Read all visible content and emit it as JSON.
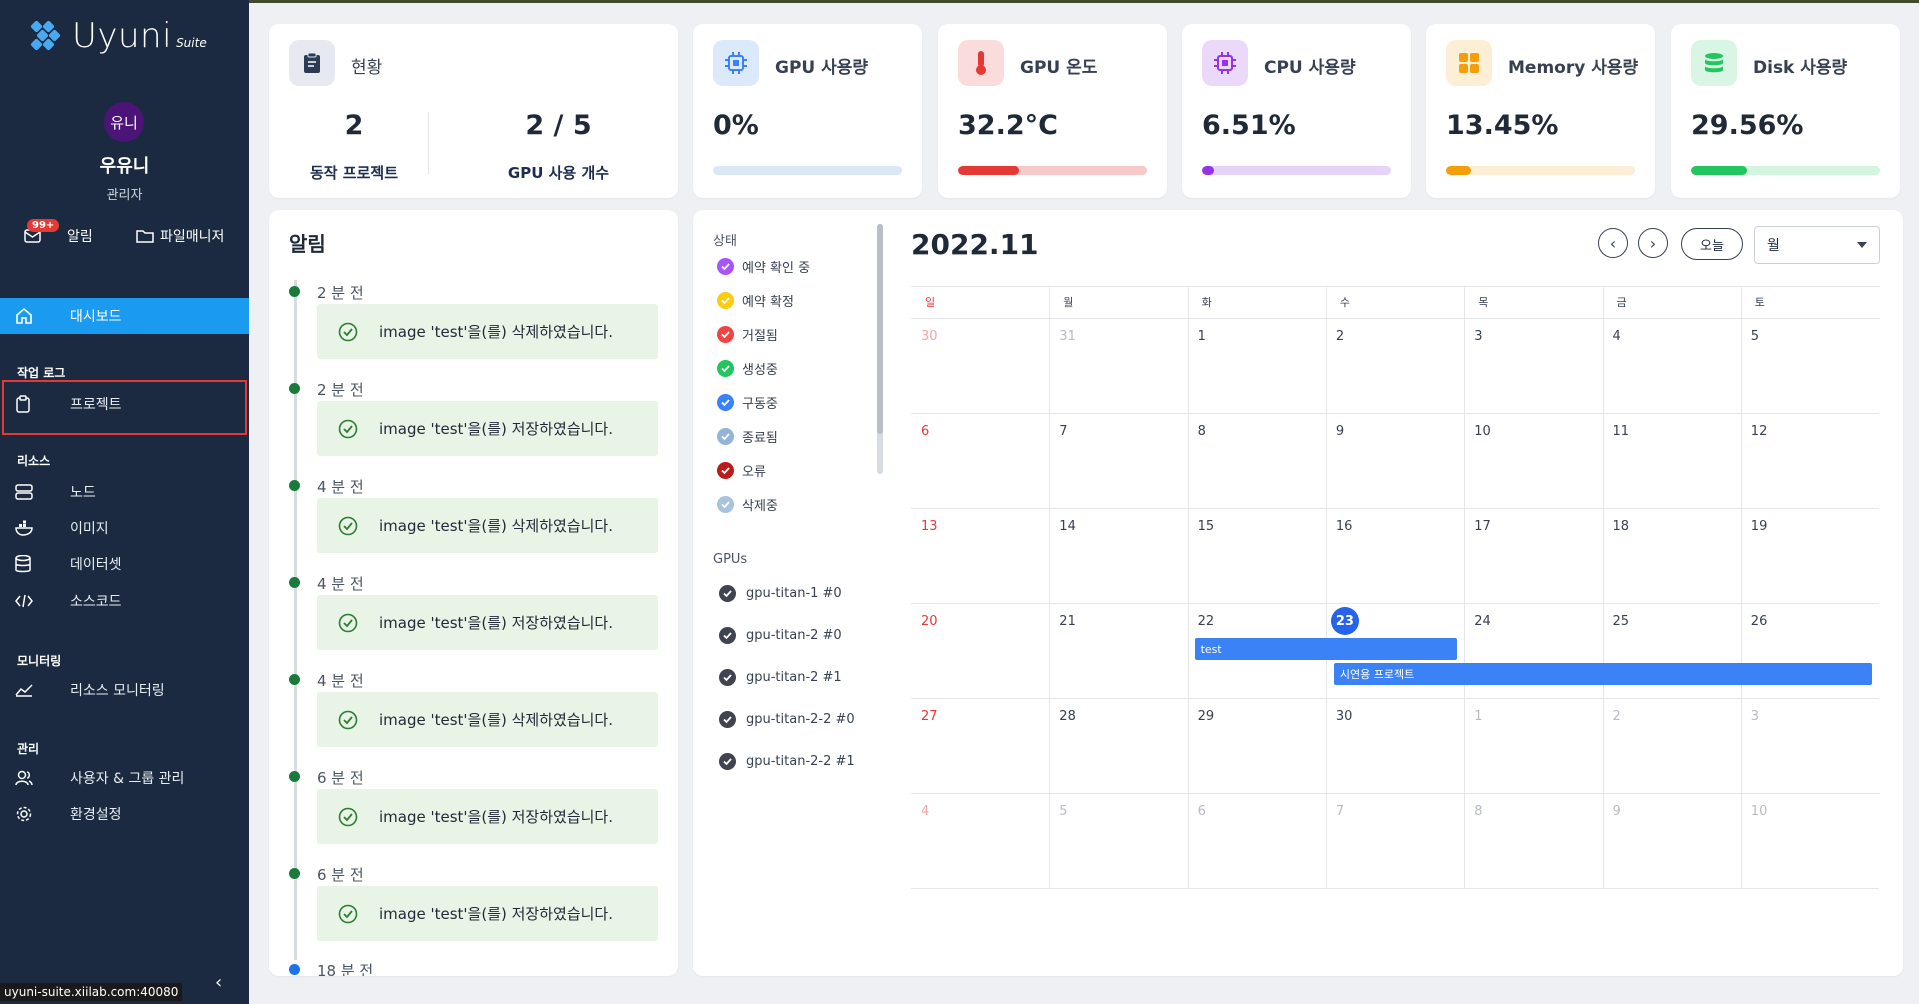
{
  "sidebar": {
    "logo_word": "Uyuni",
    "logo_suite": "Suite",
    "avatar_text": "유니",
    "user_name": "우유니",
    "user_role": "관리자",
    "alert_badge": "99+",
    "alert_label": "알림",
    "filemanager_label": "파일매니저",
    "dashboard": "대시보드",
    "section_worklog": "작업 로그",
    "project": "프로젝트",
    "section_resource": "리소스",
    "node": "노드",
    "image": "이미지",
    "dataset": "데이터셋",
    "sourcecode": "소스코드",
    "section_monitoring": "모니터링",
    "resource_monitoring": "리소스 모니터링",
    "section_admin": "관리",
    "user_group": "사용자 & 그룹 관리",
    "settings": "환경설정",
    "collapse_glyph": "‹"
  },
  "status_url": "uyuni-suite.xiilab.com:40080",
  "summary": {
    "title": "현황",
    "projects_value": "2",
    "projects_label": "동작 프로젝트",
    "gpu_value": "2 / 5",
    "gpu_label": "GPU 사용 개수"
  },
  "metrics": [
    {
      "title": "GPU 사용량",
      "value": "0%",
      "percent": 0,
      "color": "#3b82f6",
      "track": "#dbe6f7",
      "iconbg": "#dbe9fb",
      "icon": "chip-icon"
    },
    {
      "title": "GPU 온도",
      "value": "32.2°C",
      "percent": 32.2,
      "color": "#e53935",
      "track": "#f7c9c9",
      "iconbg": "#fbdcdc",
      "icon": "thermometer-icon"
    },
    {
      "title": "CPU 사용량",
      "value": "6.51%",
      "percent": 6.51,
      "color": "#9333ea",
      "track": "#e6d3f8",
      "iconbg": "#ead9f9",
      "icon": "chip-icon"
    },
    {
      "title": "Memory 사용량",
      "value": "13.45%",
      "percent": 13.45,
      "color": "#f59e0b",
      "track": "#fdeed6",
      "iconbg": "#fdeed6",
      "icon": "memory-icon"
    },
    {
      "title": "Disk 사용량",
      "value": "29.56%",
      "percent": 29.56,
      "color": "#22c55e",
      "track": "#d3f4df",
      "iconbg": "#d9f5e3",
      "icon": "database-icon"
    }
  ],
  "notifications": {
    "title": "알림",
    "items": [
      {
        "time": "2 분 전",
        "message": "image 'test'을(를) 삭제하였습니다."
      },
      {
        "time": "2 분 전",
        "message": "image 'test'을(를) 저장하였습니다."
      },
      {
        "time": "4 분 전",
        "message": "image 'test'을(를) 삭제하였습니다."
      },
      {
        "time": "4 분 전",
        "message": "image 'test'을(를) 저장하였습니다."
      },
      {
        "time": "4 분 전",
        "message": "image 'test'을(를) 삭제하였습니다."
      },
      {
        "time": "6 분 전",
        "message": "image 'test'을(를) 저장하였습니다."
      },
      {
        "time": "6 분 전",
        "message": "image 'test'을(를) 저장하였습니다."
      }
    ],
    "last_time": "18 분 전"
  },
  "legend": {
    "status_heading": "상태",
    "statuses": [
      {
        "label": "예약 확인 중",
        "color": "#a855f7"
      },
      {
        "label": "예약 확정",
        "color": "#facc15"
      },
      {
        "label": "거절됨",
        "color": "#ef4444"
      },
      {
        "label": "생성중",
        "color": "#22c55e"
      },
      {
        "label": "구동중",
        "color": "#3b82f6"
      },
      {
        "label": "종료됨",
        "color": "#93b4d8"
      },
      {
        "label": "오류",
        "color": "#b91c1c"
      },
      {
        "label": "삭제중",
        "color": "#a9c3dd"
      }
    ],
    "gpus_heading": "GPUs",
    "gpus": [
      "gpu-titan-1 #0",
      "gpu-titan-2 #0",
      "gpu-titan-2 #1",
      "gpu-titan-2-2 #0",
      "gpu-titan-2-2 #1"
    ]
  },
  "calendar": {
    "title": "2022.11",
    "prev": "‹",
    "next": "›",
    "today_label": "오늘",
    "view_label": "월",
    "weekdays": [
      "일",
      "월",
      "화",
      "수",
      "목",
      "금",
      "토"
    ],
    "weeks": [
      [
        "30",
        "31",
        "1",
        "2",
        "3",
        "4",
        "5"
      ],
      [
        "6",
        "7",
        "8",
        "9",
        "10",
        "11",
        "12"
      ],
      [
        "13",
        "14",
        "15",
        "16",
        "17",
        "18",
        "19"
      ],
      [
        "20",
        "21",
        "22",
        "23",
        "24",
        "25",
        "26"
      ],
      [
        "27",
        "28",
        "29",
        "30",
        "1",
        "2",
        "3"
      ],
      [
        "4",
        "5",
        "6",
        "7",
        "8",
        "9",
        "10"
      ]
    ],
    "today": "23",
    "events": [
      {
        "title": "test"
      },
      {
        "title": "시연용 프로젝트"
      }
    ]
  }
}
